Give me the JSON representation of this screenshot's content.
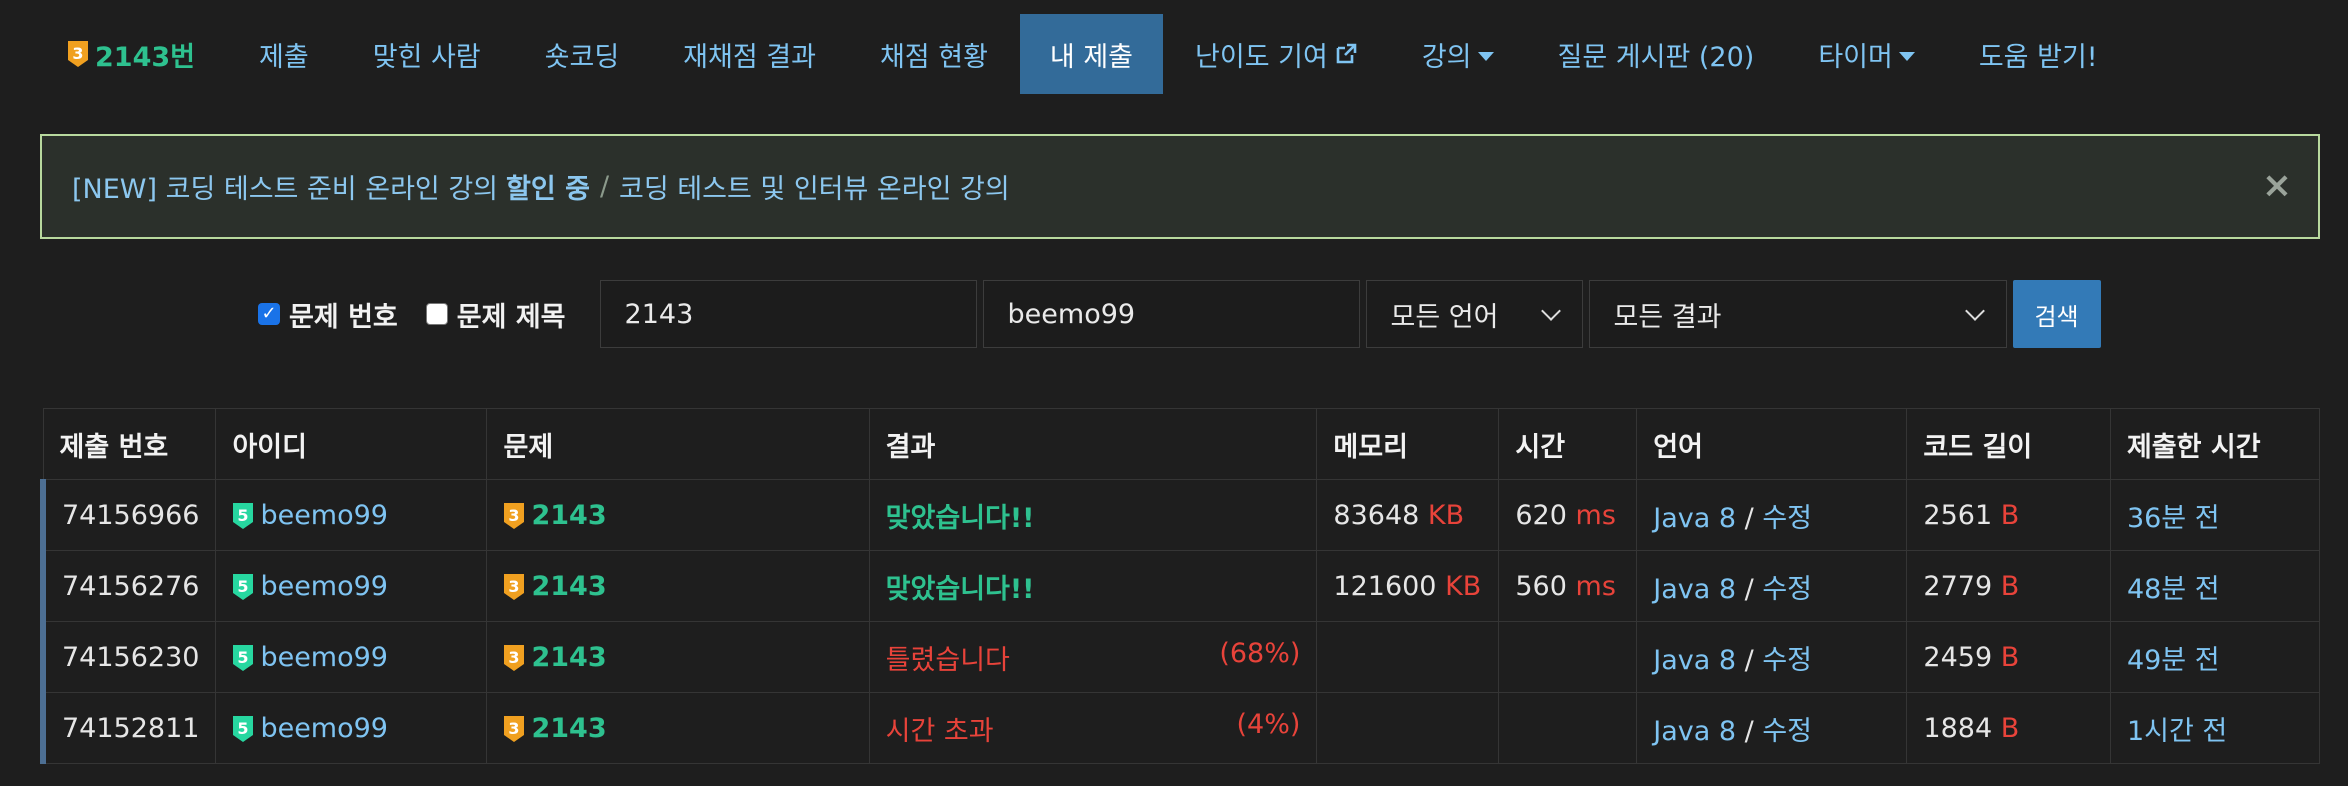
{
  "nav": {
    "problem_number": "2143번",
    "items": [
      "제출",
      "맞힌 사람",
      "숏코딩",
      "재채점 결과",
      "채점 현황",
      "내 제출",
      "난이도 기여",
      "강의",
      "질문 게시판 (20)",
      "타이머",
      "도움 받기!"
    ],
    "active_index": 5,
    "problem_tier": "3"
  },
  "notice": {
    "prefix": "[NEW] 코딩 테스트 준비 온라인 강의",
    "highlight": "할인 중",
    "separator": "/",
    "suffix": "코딩 테스트 및 인터뷰 온라인 강의",
    "close": "×"
  },
  "filters": {
    "problem_number_label": "문제 번호",
    "problem_number_checked": true,
    "problem_title_label": "문제 제목",
    "problem_title_checked": false,
    "problem_input": "2143",
    "user_input": "beemo99",
    "language_select": "모든 언어",
    "result_select": "모든 결과",
    "search_button": "검색"
  },
  "table": {
    "headers": [
      "제출 번호",
      "아이디",
      "문제",
      "결과",
      "메모리",
      "시간",
      "언어",
      "코드 길이",
      "제출한 시간"
    ],
    "rows": [
      {
        "id": "74156966",
        "user": "beemo99",
        "user_tier": "5",
        "problem": "2143",
        "problem_tier": "3",
        "result": "맞았습니다!!",
        "result_type": "accepted",
        "percent": "",
        "memory": "83648",
        "memory_unit": "KB",
        "time": "620",
        "time_unit": "ms",
        "language": "Java 8",
        "edit": "수정",
        "code_length": "2561",
        "code_unit": "B",
        "submitted": "36분 전"
      },
      {
        "id": "74156276",
        "user": "beemo99",
        "user_tier": "5",
        "problem": "2143",
        "problem_tier": "3",
        "result": "맞았습니다!!",
        "result_type": "accepted",
        "percent": "",
        "memory": "121600",
        "memory_unit": "KB",
        "time": "560",
        "time_unit": "ms",
        "language": "Java 8",
        "edit": "수정",
        "code_length": "2779",
        "code_unit": "B",
        "submitted": "48분 전"
      },
      {
        "id": "74156230",
        "user": "beemo99",
        "user_tier": "5",
        "problem": "2143",
        "problem_tier": "3",
        "result": "틀렸습니다",
        "result_type": "wrong",
        "percent": "(68%)",
        "memory": "",
        "memory_unit": "",
        "time": "",
        "time_unit": "",
        "language": "Java 8",
        "edit": "수정",
        "code_length": "2459",
        "code_unit": "B",
        "submitted": "49분 전"
      },
      {
        "id": "74152811",
        "user": "beemo99",
        "user_tier": "5",
        "problem": "2143",
        "problem_tier": "3",
        "result": "시간 초과",
        "result_type": "wrong",
        "percent": "(4%)",
        "memory": "",
        "memory_unit": "",
        "time": "",
        "time_unit": "",
        "language": "Java 8",
        "edit": "수정",
        "code_length": "1884",
        "code_unit": "B",
        "submitted": "1시간 전"
      }
    ]
  },
  "colors": {
    "accent_link": "#7fc4f2",
    "accepted": "#2ec18f",
    "error": "#e8433a",
    "active_tab": "#336b99",
    "gold_tier": "#f0a020",
    "platinum_tier": "#27d7a0"
  },
  "icons": {
    "external": "external-link-icon",
    "close": "close-icon",
    "caret": "caret-down-icon",
    "chevron": "chevron-down-icon"
  }
}
